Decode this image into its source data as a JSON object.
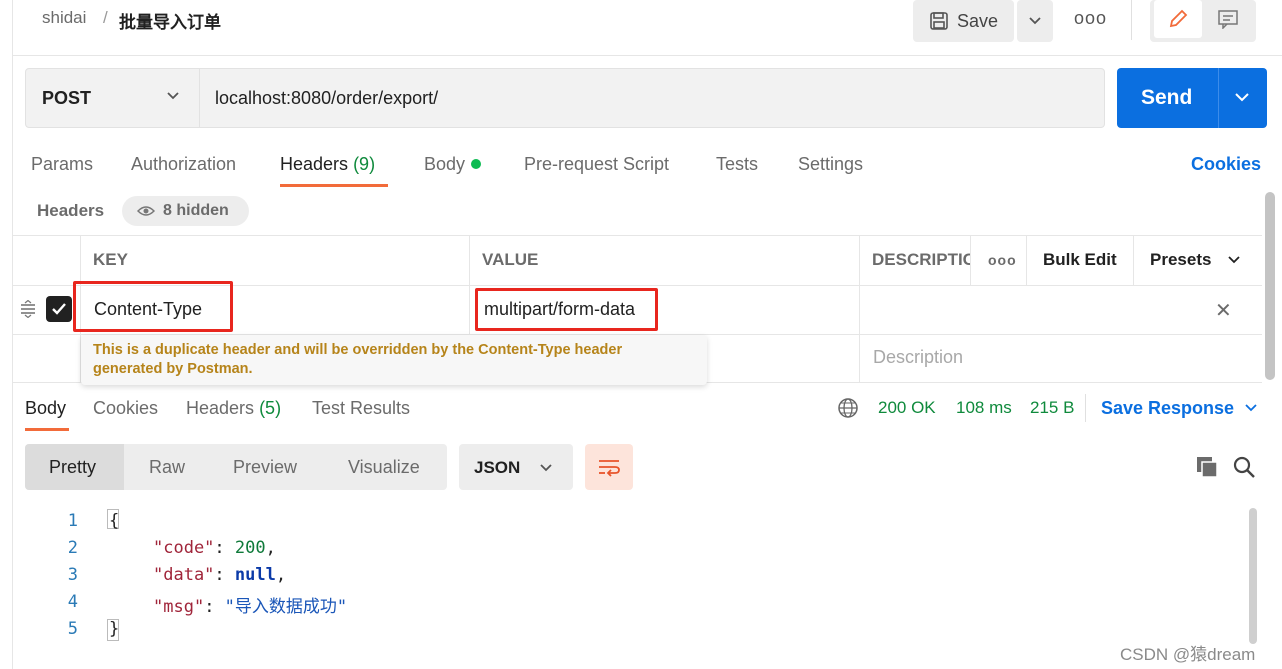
{
  "breadcrumb": {
    "workspace": "shidai",
    "separator": "/",
    "request_name": "批量导入订单"
  },
  "toolbar": {
    "save_label": "Save"
  },
  "request": {
    "method": "POST",
    "url": "localhost:8080/order/export/",
    "send_label": "Send"
  },
  "tabs": {
    "params": "Params",
    "authorization": "Authorization",
    "headers": "Headers",
    "headers_count": "(9)",
    "body": "Body",
    "pre_request": "Pre-request Script",
    "tests": "Tests",
    "settings": "Settings",
    "cookies": "Cookies"
  },
  "headers_section": {
    "label": "Headers",
    "hidden": "8 hidden"
  },
  "headers_table": {
    "columns": {
      "key": "KEY",
      "value": "VALUE",
      "description": "DESCRIPTIC",
      "bulk_edit": "Bulk Edit",
      "presets": "Presets"
    },
    "rows": [
      {
        "key": "Content-Type",
        "value": "multipart/form-data",
        "enabled": true
      }
    ],
    "description_placeholder": "Description",
    "warning": "This is a duplicate header and will be overridden by the Content-Type header generated by Postman."
  },
  "response": {
    "tabs": {
      "body": "Body",
      "cookies": "Cookies",
      "headers": "Headers",
      "headers_count": "(5)",
      "test_results": "Test Results"
    },
    "status": "200 OK",
    "time": "108 ms",
    "size": "215 B",
    "save_response": "Save Response",
    "views": {
      "pretty": "Pretty",
      "raw": "Raw",
      "preview": "Preview",
      "visualize": "Visualize"
    },
    "format": "JSON",
    "body_lines": [
      {
        "n": "1",
        "text": "{"
      },
      {
        "n": "2",
        "key": "\"code\"",
        "value": "200"
      },
      {
        "n": "3",
        "key": "\"data\"",
        "value": "null"
      },
      {
        "n": "4",
        "key": "\"msg\"",
        "value": "\"导入数据成功\""
      },
      {
        "n": "5",
        "text": "}"
      }
    ]
  },
  "watermark": "CSDN @猿dream",
  "colors": {
    "accent_blue": "#0b6fe0",
    "tab_underline": "#f26b3a",
    "status_green": "#0f8a3c",
    "highlight_red": "#e8261e"
  }
}
